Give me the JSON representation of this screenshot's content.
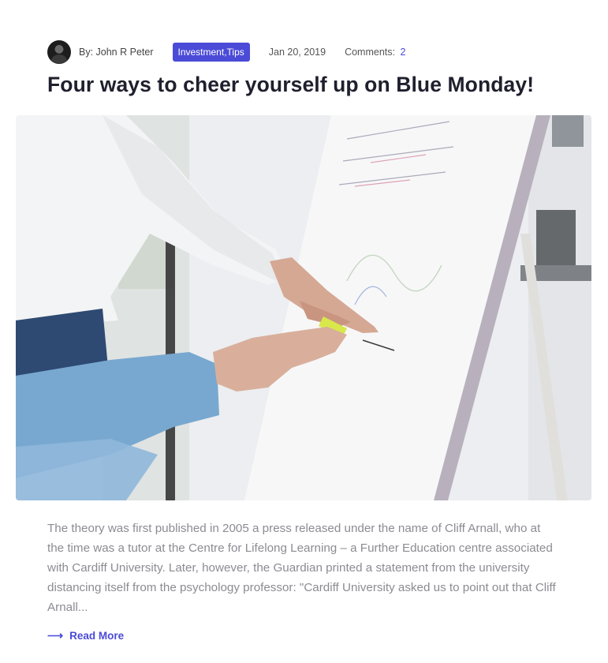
{
  "post": {
    "author_label": "By: John R Peter",
    "categories": [
      "Investment",
      "Tips"
    ],
    "category_separator": " ,",
    "date": "Jan 20, 2019",
    "comments_label": "Comments:",
    "comments_count": "2",
    "title": "Four ways to cheer yourself up on Blue Monday!",
    "excerpt": "The theory was first published in 2005 a press released under the name of Cliff Arnall, who at the time was a tutor at the Centre for Lifelong Learning – a Further Education centre associated with Cardiff University. Later, however, the Guardian printed a statement from the university distancing itself from the psychology professor: \"Cardiff University asked us to point out that Cliff Arnall...",
    "read_more_label": "Read More"
  },
  "icons": {
    "avatar": "user-avatar-photo",
    "read_more": "arrow-right-icon"
  },
  "colors": {
    "accent": "#4b4bd8",
    "title": "#1f1f2e",
    "excerpt": "#8b8b93"
  }
}
